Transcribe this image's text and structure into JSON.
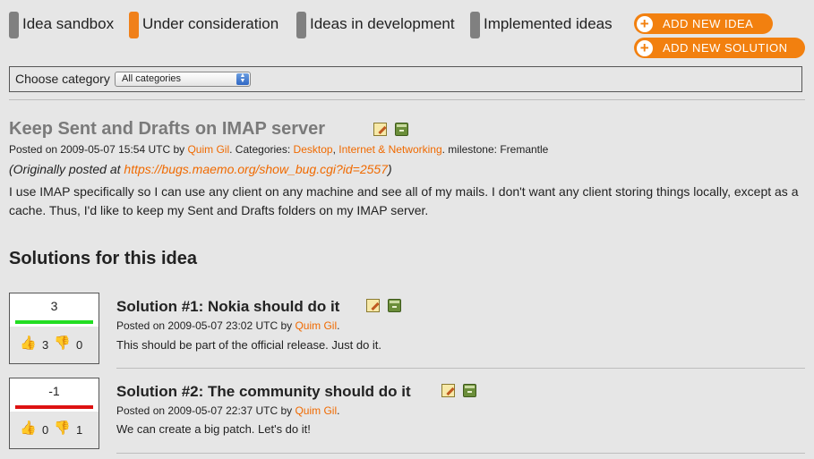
{
  "tabs": [
    {
      "label": "Idea sandbox",
      "active": false
    },
    {
      "label": "Under consideration",
      "active": true
    },
    {
      "label": "Ideas in development",
      "active": false
    },
    {
      "label": "Implemented ideas",
      "active": false
    }
  ],
  "actions": {
    "add_idea": "ADD NEW IDEA",
    "add_solution": "ADD NEW SOLUTION"
  },
  "category": {
    "label": "Choose category",
    "selected": "All categories"
  },
  "idea": {
    "title": "Keep Sent and Drafts on IMAP server",
    "posted_prefix": "Posted on 2009-05-07 15:54 UTC by",
    "author": "Quim Gil",
    "categories_label": ". Categories:",
    "categories": [
      "Desktop",
      "Internet & Networking"
    ],
    "milestone": ". milestone: Fremantle",
    "origin_prefix": "(Originally posted at ",
    "origin_link": "https://bugs.maemo.org/show_bug.cgi?id=2557",
    "origin_suffix": ")",
    "body": "I use IMAP specifically so I can use any client on any machine and see all of my mails. I don't want any client storing things locally, except as a cache. Thus, I'd like to keep my Sent and Drafts folders on my IMAP server."
  },
  "solutions_heading": "Solutions for this idea",
  "solutions": [
    {
      "score": "3",
      "score_color": "#22dd22",
      "up": "3",
      "down": "0",
      "title": "Solution #1: Nokia should do it",
      "posted": "Posted on 2009-05-07 23:02 UTC by",
      "author": "Quim Gil",
      "period": ".",
      "body": "This should be part of the official release. Just do it."
    },
    {
      "score": "-1",
      "score_color": "#dd1111",
      "up": "0",
      "down": "1",
      "title": "Solution #2: The community should do it",
      "posted": "Posted on 2009-05-07 22:37 UTC by",
      "author": "Quim Gil",
      "period": ".",
      "body": "We can create a big patch. Let's do it!"
    }
  ],
  "colors": {
    "accent": "#f06a00",
    "active_tab": "#f0801a",
    "inactive_tab": "#808080"
  }
}
